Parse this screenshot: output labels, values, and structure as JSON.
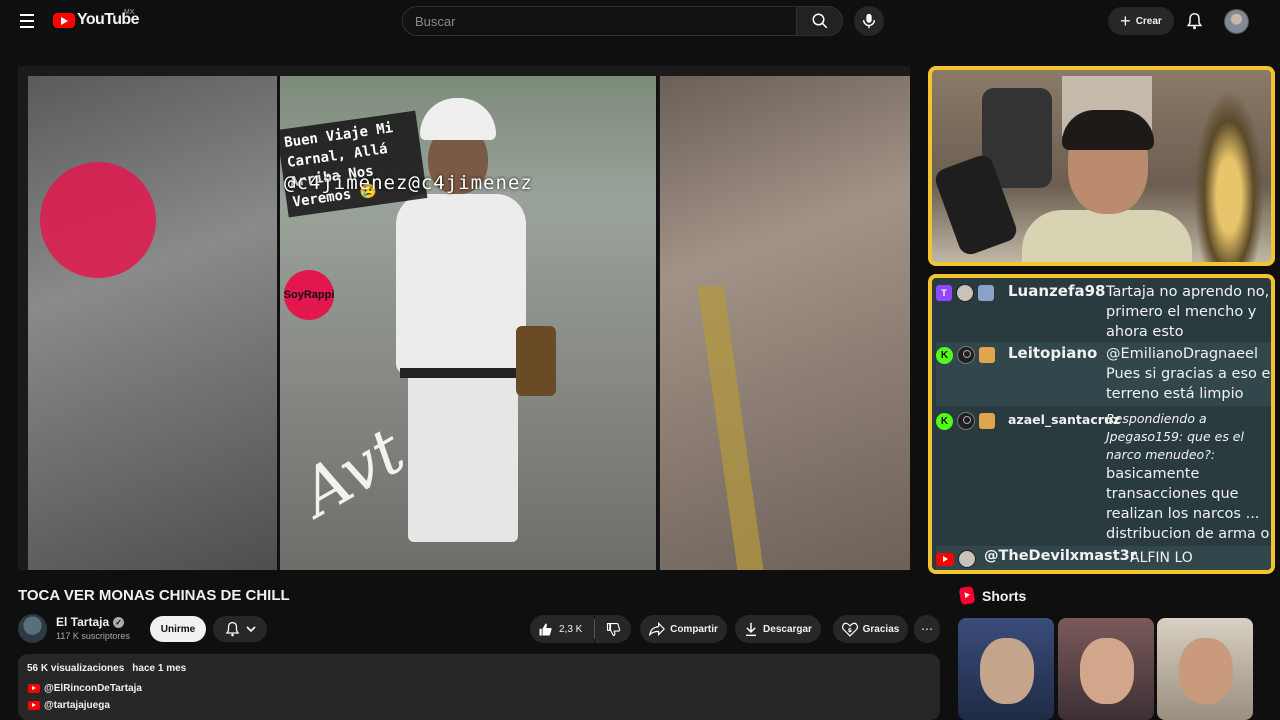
{
  "header": {
    "logo_text": "YouTube",
    "region": "MX",
    "search_placeholder": "Buscar",
    "create_label": "Crear"
  },
  "video": {
    "title": "TOCA VER MONAS CHINAS DE CHILL",
    "overlay": {
      "caption": "Buen Viaje Mi Carnal, Allá Arriba Nos Veremos 😢",
      "handle": "@c4jimenez@c4jimenez",
      "sticker": "SoyRappi",
      "signature": "Avt"
    }
  },
  "channel": {
    "name": "El Tartaja",
    "verified_mark": "✓",
    "subscribers": "117 K suscriptores",
    "join_label": "Unirme"
  },
  "actions": {
    "likes": "2,3 K",
    "share_label": "Compartir",
    "download_label": "Descargar",
    "thanks_label": "Gracias"
  },
  "description": {
    "views": "56 K visualizaciones",
    "date": "hace 1 mes",
    "links": [
      "@ElRinconDeTartaja",
      "@tartajajuega"
    ]
  },
  "chat": {
    "messages": [
      {
        "platform": "twitch",
        "user": "Luanzefa98",
        "text": "Tartaja no aprendo no, primero el mencho y ahora esto"
      },
      {
        "platform": "kick",
        "user": "Leitopiano",
        "text": "@EmilianoDragnaeel Pues si gracias a eso el terreno está limpio"
      },
      {
        "platform": "kick",
        "user": "azael_santacruz",
        "reply": "Respondiendo a Jpegaso159: que es el narco menudeo?:",
        "text": "basicamente transacciones que realizan los narcos ... distribucion de arma o drogas"
      },
      {
        "platform": "youtube",
        "user": "@TheDevilxmast3r",
        "text": "ALFIN LO REVIVIERON"
      }
    ]
  },
  "shorts": {
    "label": "Shorts"
  },
  "colors": {
    "background": "#0f0f0f",
    "accent_red": "#ff0000",
    "stream_frame": "#f4c430",
    "chat_bg": "#2a3b3f"
  }
}
